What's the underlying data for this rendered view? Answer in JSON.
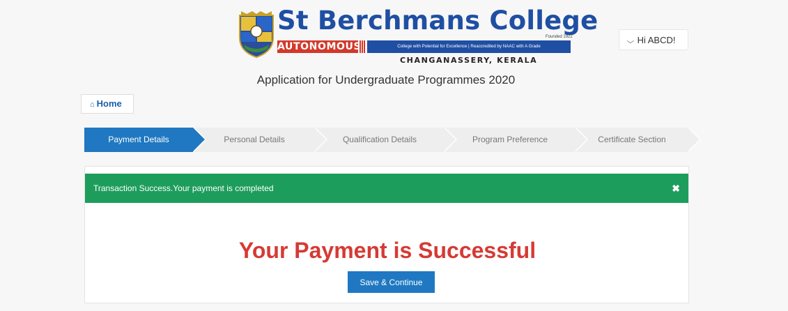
{
  "header": {
    "college_name": "St Berchmans College",
    "founded": "Founded 1922",
    "autonomous": "AUTONOMOUS",
    "tagline": "College with Potential for Excellence | Reaccredited by NAAC with A Grade",
    "location": "CHANGANASSERY, KERALA",
    "user_menu": {
      "icon": "chevron-down-icon",
      "label": "Hi ABCD!"
    }
  },
  "page_heading": "Application for Undergraduate Programmes 2020",
  "home_button": {
    "icon": "home-icon",
    "label": "Home"
  },
  "wizard": {
    "steps": [
      {
        "label": "Payment Details",
        "active": true
      },
      {
        "label": "Personal Details",
        "active": false
      },
      {
        "label": "Qualification Details",
        "active": false
      },
      {
        "label": "Program Preference",
        "active": false
      },
      {
        "label": "Certificate Section",
        "active": false
      }
    ]
  },
  "alert": {
    "message": "Transaction Success.Your payment is completed",
    "close_icon": "close-icon"
  },
  "result": {
    "title": "Your Payment is Successful",
    "button_label": "Save & Continue"
  },
  "colors": {
    "brand_blue": "#1f4fa3",
    "accent_blue": "#1f78c1",
    "success_green": "#1d9d5c",
    "error_red": "#d63a34",
    "autonomous_red": "#d2392b"
  }
}
